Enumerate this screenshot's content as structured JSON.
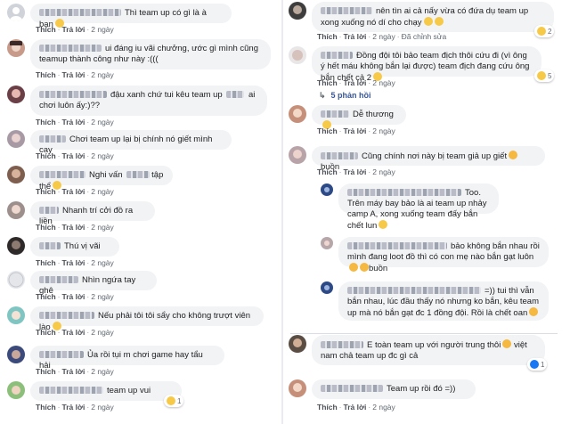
{
  "labels": {
    "like": "Thích",
    "reply": "Trả lời",
    "time": "2 ngày",
    "edited": "Đã chỉnh sửa",
    "replies": "5 phản hồi"
  },
  "colors": {
    "bubble": "#f2f3f5",
    "link": "#385898",
    "meta": "#606770",
    "like_blue": "#1877f2",
    "haha_yellow": "#f7c948"
  },
  "left": [
    {
      "text": "Thì team up có gì là à bạn",
      "emoji": "haha"
    },
    {
      "text": "ui đáng iu vãi chưởng, ước gì mình cũng teamup thành công như này :((("
    },
    {
      "text": "đậu xanh chứ tui kêu team up",
      "text2": "ai chơi luôn ấy:)??"
    },
    {
      "text": "Chơi team up lại bị chính nó giết mình cay"
    },
    {
      "text": "Nghi vấn",
      "text2": "tập thể",
      "emoji": "haha"
    },
    {
      "text": "Nhanh trí cởi đồ ra liền"
    },
    {
      "text": "Thú vị vãi"
    },
    {
      "text": "Nhìn ngứa tay ghê"
    },
    {
      "text": "Nếu phải tôi tôi sẩy cho không trượt viên lào",
      "emoji": "haha"
    },
    {
      "text": "Ủa rồi tụi m chơi game hay tẩu hải"
    },
    {
      "text": "team up vui",
      "reaction_count": "1"
    }
  ],
  "right": {
    "c1": {
      "text": "nên tìn ai cả nấy vừa có đứa dụ team up xong xuống nó dí cho chạy",
      "reaction_count": "2"
    },
    "c2": {
      "text": "Đồng đội tôi bảo team địch thôi cứu đi (vì ông ý hết máu không bắn lại được) team địch đang cứu ông bắn chết cả 2",
      "reaction_count": "5"
    },
    "c3": {
      "text": "Dễ thương"
    },
    "c4": {
      "text": "Cũng chính nơi này bị team giả up giết",
      "text2": "buồn"
    },
    "r1": {
      "text": "Too. Trên máy bay bảo là ai team up nhảy camp A, xong xuống team đấy bắn chết lun"
    },
    "r2": {
      "text": "bảo không bắn nhau rồi mình đang loot đồ thì có con mẹ nào bắn gạt luôn",
      "text2": "buồn"
    },
    "r3": {
      "text": "=)) tui thì vẫn bắn nhau, lúc đầu thấy nó nhưng ko bắn, kêu team up mà nó bắn gạt đc 1 đồng đội. Rồi là chết oan"
    },
    "c5": {
      "text": "E toàn team up với người trung thôi",
      "text2": "việt nam chả team up đc gì cả",
      "reaction_count": "1"
    },
    "c6": {
      "text": "Team up rồi đó =))"
    }
  }
}
